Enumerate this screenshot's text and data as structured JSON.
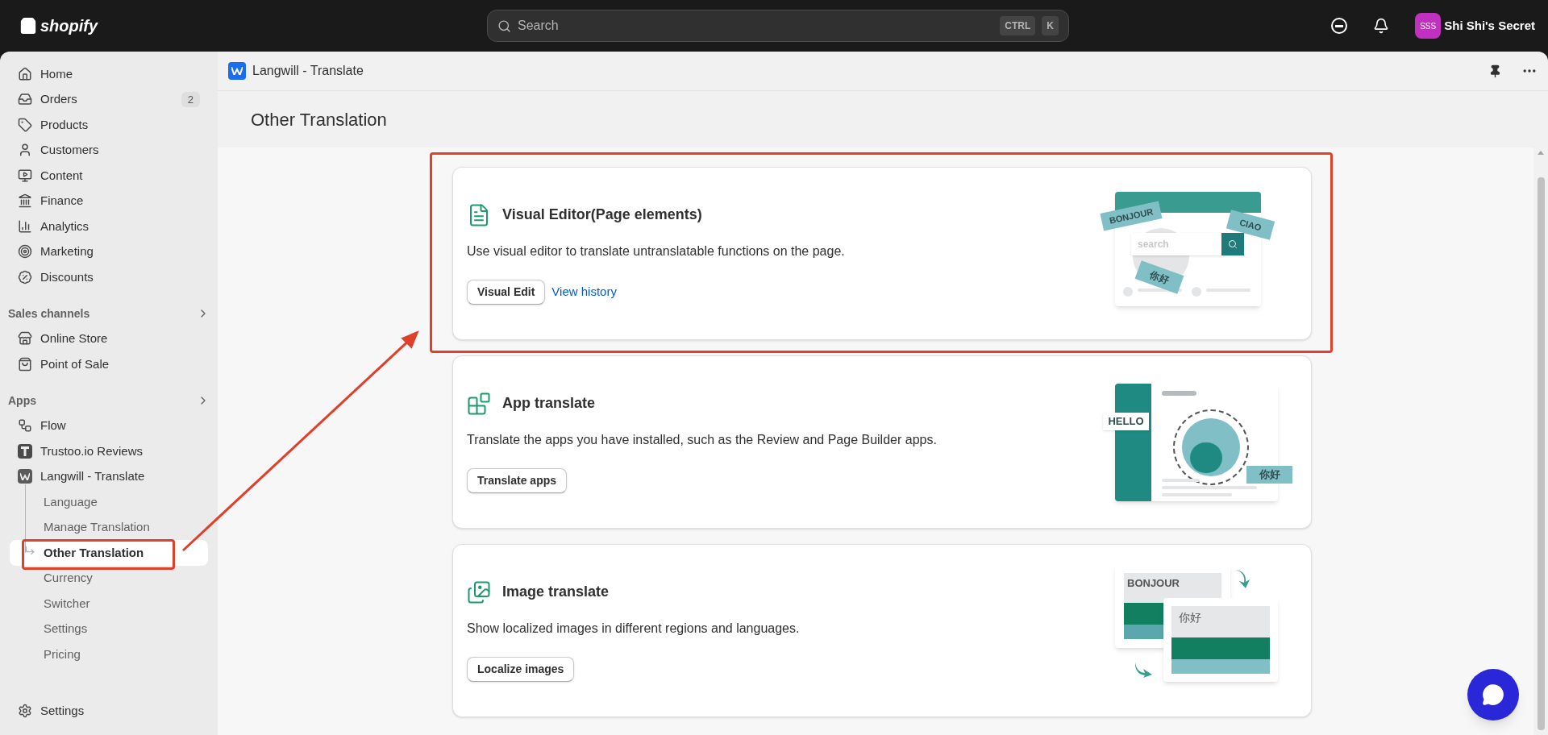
{
  "topbar": {
    "logo_text": "shopify",
    "search": {
      "placeholder": "Search"
    },
    "shortcut_keys": [
      "CTRL",
      "K"
    ],
    "store": {
      "avatar": "SSS",
      "name": "Shi Shi's Secret"
    }
  },
  "sidebar": {
    "main_items": [
      {
        "label": "Home",
        "selected": false
      },
      {
        "label": "Orders",
        "selected": false,
        "badge": "2"
      },
      {
        "label": "Products",
        "selected": false
      },
      {
        "label": "Customers",
        "selected": false
      },
      {
        "label": "Content",
        "selected": false
      },
      {
        "label": "Finance",
        "selected": false
      },
      {
        "label": "Analytics",
        "selected": false
      },
      {
        "label": "Marketing",
        "selected": false
      },
      {
        "label": "Discounts",
        "selected": false
      }
    ],
    "sections": [
      {
        "title": "Sales channels",
        "items": [
          {
            "label": "Online Store",
            "selected": false
          },
          {
            "label": "Point of Sale",
            "selected": false
          }
        ]
      },
      {
        "title": "Apps",
        "items": [
          {
            "label": "Flow",
            "selected": false
          },
          {
            "label": "Trustoo.io Reviews",
            "selected": false
          },
          {
            "label": "Langwill - Translate",
            "selected": false,
            "expanded": true,
            "children": [
              {
                "label": "Language",
                "selected": false,
                "annotated": false
              },
              {
                "label": "Manage Translation",
                "selected": false,
                "annotated": false
              },
              {
                "label": "Other Translation",
                "selected": true,
                "annotated": true
              },
              {
                "label": "Currency",
                "selected": false,
                "annotated": false
              },
              {
                "label": "Switcher",
                "selected": false,
                "annotated": false
              },
              {
                "label": "Settings",
                "selected": false,
                "annotated": false
              },
              {
                "label": "Pricing",
                "selected": false,
                "annotated": false
              }
            ]
          }
        ]
      }
    ],
    "footer_item": {
      "label": "Settings",
      "selected": false
    }
  },
  "app_header": {
    "title": "Langwill - Translate"
  },
  "page_title": "Other Translation",
  "cards": [
    {
      "title": "Visual Editor(Page elements)",
      "description": "Use visual editor to translate untranslatable functions on the page.",
      "annotated": true,
      "buttons": [
        {
          "label": "Visual Edit",
          "kind": "secondary"
        },
        {
          "label": "View history",
          "kind": "link"
        }
      ],
      "illustration": {
        "kind": "visual-editor",
        "labels": [
          "BONJOUR",
          "CIAO",
          "search",
          "你好"
        ]
      }
    },
    {
      "title": "App translate",
      "description": "Translate the apps you have installed, such as the Review and Page Builder apps.",
      "annotated": false,
      "buttons": [
        {
          "label": "Translate apps",
          "kind": "secondary"
        }
      ],
      "illustration": {
        "kind": "app",
        "labels": [
          "HELLO",
          "你好"
        ]
      }
    },
    {
      "title": "Image translate",
      "description": "Show localized images in different regions and languages.",
      "annotated": false,
      "buttons": [
        {
          "label": "Localize images",
          "kind": "secondary"
        }
      ],
      "illustration": {
        "kind": "image",
        "labels": [
          "BONJOUR",
          "你好"
        ]
      }
    }
  ]
}
